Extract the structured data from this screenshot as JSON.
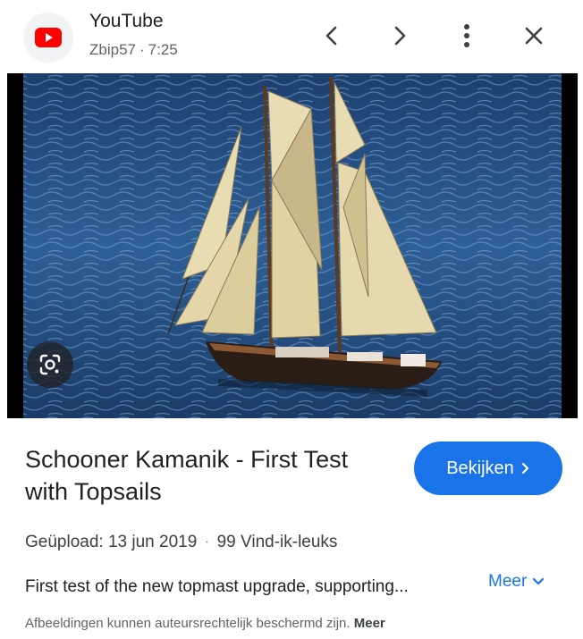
{
  "header": {
    "source": "YouTube",
    "channel": "Zbip57",
    "duration": "7:25",
    "icons": [
      "youtube-logo-icon",
      "chevron-left-icon",
      "chevron-right-icon",
      "more-vert-icon",
      "close-icon"
    ]
  },
  "colors": {
    "accent": "#1a73e8",
    "youtube_red": "#ff0000",
    "text_primary": "#202124",
    "text_secondary": "#5f6368"
  },
  "media": {
    "lens_icon": "google-lens-icon"
  },
  "video": {
    "title": "Schooner Kamanik - First Test with Topsails",
    "watch_label": "Bekijken",
    "uploaded": "Geüpload: 13 jun 2019",
    "likes": "99 Vind-ik-leuks",
    "description": "First test of the new topmast upgrade, supporting...",
    "more_label": "Meer"
  },
  "footer": {
    "notice": "Afbeeldingen kunnen auteursrechtelijk beschermd zijn.",
    "notice_link": "Meer"
  }
}
